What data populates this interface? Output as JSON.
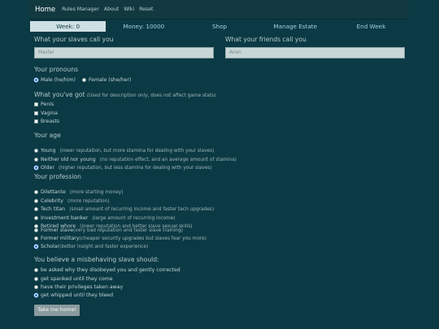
{
  "nav": {
    "brand": "Home",
    "links": [
      "Rules Manager",
      "About",
      "Wiki",
      "Reset"
    ]
  },
  "stats": [
    "Week: 0",
    "Money: 10000",
    "Shop",
    "Manage Estate",
    "End Week"
  ],
  "names": {
    "slave_label": "What your slaves call you",
    "slave_value": "Master",
    "friend_label": "What your friends call you",
    "friend_value": "Anon"
  },
  "pronouns": {
    "title": "Your pronouns",
    "options": [
      "Male (he/him)",
      "Female (she/her)"
    ]
  },
  "got": {
    "title": "What you've got",
    "note": "(Used for description only, does not affect game stats)",
    "options": [
      "Penis",
      "Vagina",
      "Breasts"
    ]
  },
  "age": {
    "title": "Your age",
    "options": [
      {
        "label": "Young",
        "desc": "(lower reputation, but more stamina for dealing with your slaves)"
      },
      {
        "label": "Neither old nor young",
        "desc": "(no reputation effect, and an average amount of stamina)"
      },
      {
        "label": "Older",
        "desc": "(higher reputation, but less stamina for dealing with your slaves)"
      }
    ]
  },
  "profession": {
    "title": "Your profession",
    "options": [
      {
        "label": "Dilettante",
        "desc": "(more starting money)"
      },
      {
        "label": "Celebrity",
        "desc": "(more reputation)"
      },
      {
        "label": "Tech titan",
        "desc": "(small amount of recurring income and faster tech upgrades)"
      },
      {
        "label": "Investment banker",
        "desc": "(large amount of recurring income)"
      },
      {
        "label": "Retired whore",
        "desc": "(lower reputation and better slave sexual skills)"
      },
      {
        "label": "Former slave",
        "desc": "(very bad reputation and faster slave training)"
      },
      {
        "label": "Former military",
        "desc": "(cheaper security upgrades but slaves fear you more)"
      },
      {
        "label": "Scholar",
        "desc": "(better insight and faster experience)"
      }
    ]
  },
  "misbehave": {
    "title": "You believe a misbehaving slave should:",
    "options": [
      "be asked why they disobeyed you and gently corrected",
      "get spanked until they come",
      "have their privileges taken away",
      "get whipped until they bleed"
    ]
  },
  "button": "Take me home!"
}
